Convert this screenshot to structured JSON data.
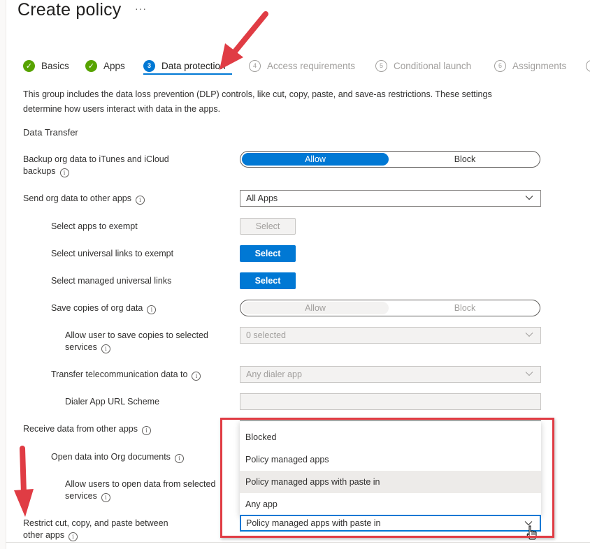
{
  "header": {
    "title": "Create policy",
    "more_label": "···"
  },
  "tabs": [
    {
      "label": "Basics",
      "state": "done",
      "marker": "✓"
    },
    {
      "label": "Apps",
      "state": "done",
      "marker": "✓"
    },
    {
      "label": "Data protection",
      "state": "current",
      "marker": "3"
    },
    {
      "label": "Access requirements",
      "state": "future",
      "marker": "4"
    },
    {
      "label": "Conditional launch",
      "state": "future",
      "marker": "5"
    },
    {
      "label": "Assignments",
      "state": "future",
      "marker": "6"
    }
  ],
  "description": "This group includes the data loss prevention (DLP) controls, like cut, copy, paste, and save-as restrictions. These settings determine how users interact with data in the apps.",
  "section_title": "Data Transfer",
  "info_glyph": "i",
  "settings": {
    "backup": {
      "label": "Backup org data to iTunes and iCloud backups",
      "options": [
        "Allow",
        "Block"
      ],
      "selected": "Allow"
    },
    "send_org_data": {
      "label": "Send org data to other apps",
      "value": "All Apps"
    },
    "select_apps_exempt": {
      "label": "Select apps to exempt",
      "button": "Select"
    },
    "select_universal_links": {
      "label": "Select universal links to exempt",
      "button": "Select"
    },
    "select_managed_links": {
      "label": "Select managed universal links",
      "button": "Select"
    },
    "save_copies": {
      "label": "Save copies of org data",
      "options": [
        "Allow",
        "Block"
      ],
      "selected": "Allow"
    },
    "save_copies_services": {
      "label": "Allow user to save copies to selected services",
      "value": "0 selected"
    },
    "telecom": {
      "label": "Transfer telecommunication data to",
      "value": "Any dialer app"
    },
    "dialer_url": {
      "label": "Dialer App URL Scheme",
      "value": ""
    },
    "receive_data": {
      "label": "Receive data from other apps"
    },
    "open_into_org": {
      "label": "Open data into Org documents"
    },
    "open_from_services": {
      "label": "Allow users to open data from selected services"
    },
    "restrict_cut_copy": {
      "label": "Restrict cut, copy, and paste between other apps",
      "value": "Policy managed apps with paste in"
    }
  },
  "dropdown_menu": {
    "options": [
      "Blocked",
      "Policy managed apps",
      "Policy managed apps with paste in",
      "Any app"
    ],
    "hovered": "Policy managed apps with paste in"
  },
  "annotation_color": "#e03c44",
  "accent_color": "#0078d4",
  "success_color": "#57a300"
}
